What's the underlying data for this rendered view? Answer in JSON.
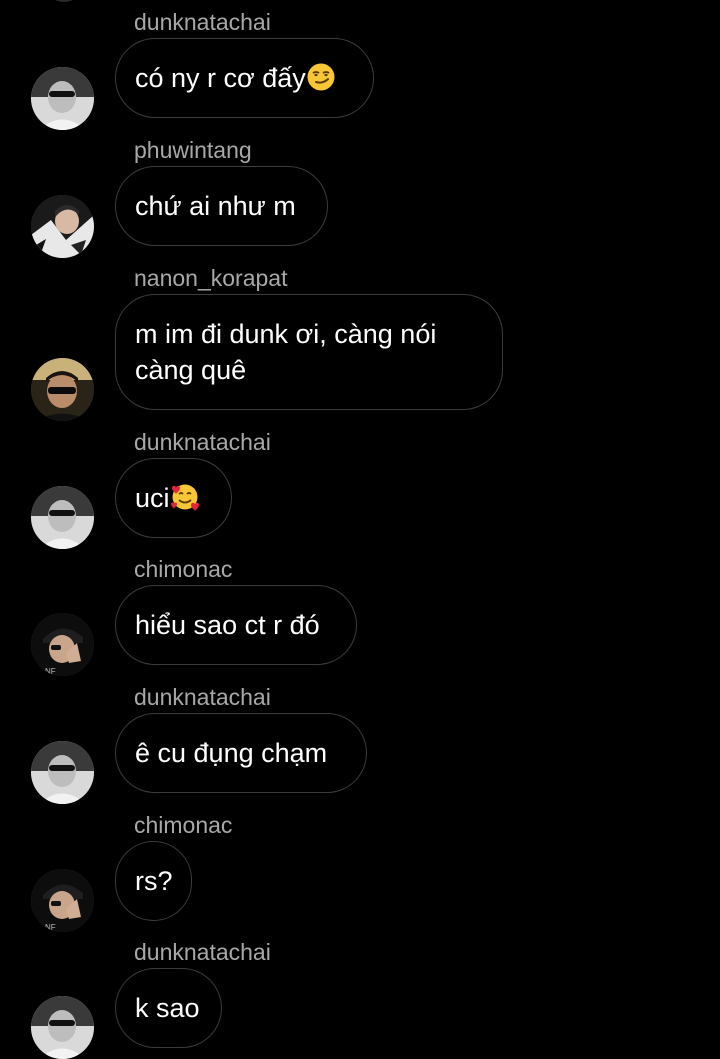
{
  "messages": [
    {
      "user": "dunknatachai",
      "text": "có ny r cơ đấy",
      "emoji": "smirking-face",
      "avatar": "avatar-dunknatachai"
    },
    {
      "user": "phuwintang",
      "text": "chứ ai như m",
      "avatar": "avatar-phuwintang"
    },
    {
      "user": "nanon_korapat",
      "text": "m im đi dunk ơi, càng nói\ncàng quê",
      "avatar": "avatar-nanon"
    },
    {
      "user": "dunknatachai",
      "text": "uci",
      "emoji": "smiling-face-with-hearts",
      "avatar": "avatar-dunknatachai"
    },
    {
      "user": "chimonac",
      "text": "hiểu sao ct r đó",
      "avatar": "avatar-chimonac"
    },
    {
      "user": "dunknatachai",
      "text": "ê cu đụng chạm",
      "avatar": "avatar-dunknatachai"
    },
    {
      "user": "chimonac",
      "text": "rs?",
      "avatar": "avatar-chimonac"
    },
    {
      "user": "dunknatachai",
      "text": "k sao",
      "avatar": "avatar-dunknatachai"
    }
  ],
  "colors": {
    "background": "#000000",
    "bubble_border": "#3c3c3c",
    "username": "#a8a8a8",
    "text": "#ffffff"
  }
}
